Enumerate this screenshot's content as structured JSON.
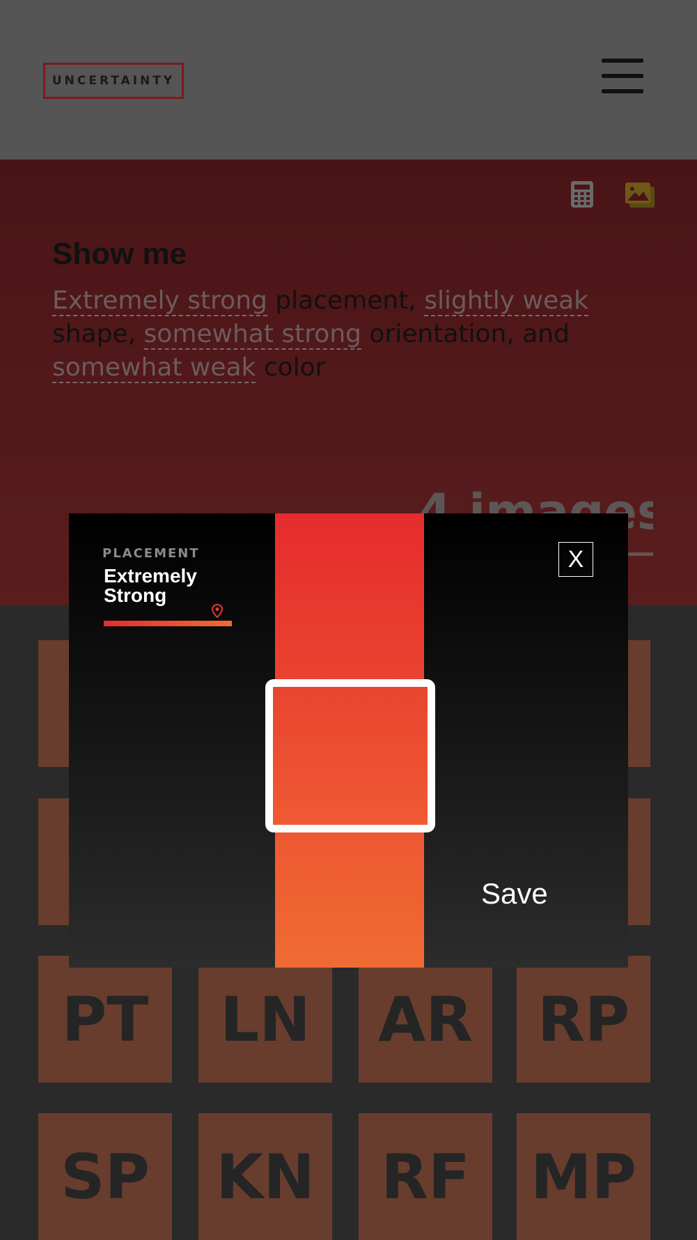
{
  "header": {
    "logo_text": "UNCERTAINTY",
    "menu_icon": "hamburger-menu-icon"
  },
  "hero": {
    "icons": [
      "calculator-icon",
      "images-icon"
    ],
    "title": "Show me",
    "sentence": [
      {
        "text": "Extremely strong",
        "selectable": true
      },
      {
        "text": " placement, ",
        "selectable": false
      },
      {
        "text": "slightly weak",
        "selectable": true
      },
      {
        "text": " shape, ",
        "selectable": false
      },
      {
        "text": "somewhat strong",
        "selectable": true
      },
      {
        "text": " orientation, and ",
        "selectable": false
      },
      {
        "text": "somewhat weak",
        "selectable": true
      },
      {
        "text": " color",
        "selectable": false
      }
    ],
    "count_text": "4 images"
  },
  "grid": {
    "rows": [
      [
        "",
        "",
        "",
        ""
      ],
      [
        "",
        "",
        "",
        ""
      ],
      [
        "PT",
        "LN",
        "AR",
        "RP"
      ],
      [
        "SP",
        "KN",
        "RF",
        "MP"
      ]
    ]
  },
  "modal": {
    "label": "PLACEMENT",
    "value": "Extremely Strong",
    "close_label": "X",
    "save_label": "Save",
    "level": 1.0
  },
  "colors": {
    "header_bg": "#555555",
    "hero_bg": "#4a1416",
    "accent_start": "#e62c2e",
    "accent_end": "#f06b33",
    "tile_bg": "#683d2e",
    "page_bg": "#2a2a2a"
  }
}
